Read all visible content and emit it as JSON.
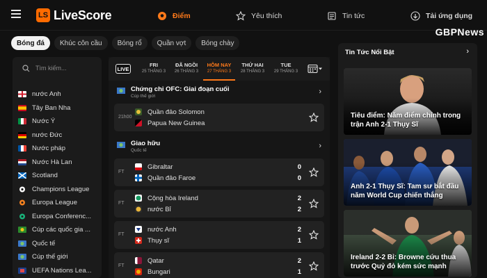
{
  "header": {
    "logo_text": "LiveScore",
    "logo_mark": "LS",
    "nav": [
      {
        "label": "Điểm",
        "icon": "soccer-ball-icon"
      },
      {
        "label": "Yêu thích",
        "icon": "star-icon"
      },
      {
        "label": "Tin tức",
        "icon": "news-icon"
      },
      {
        "label": "Tải ứng dụng",
        "icon": "download-icon"
      }
    ],
    "accent_color": "#ff7a1a"
  },
  "watermark": "GBPNews",
  "sport_tabs": [
    "Bóng đá",
    "Khúc côn cầu",
    "Bóng rổ",
    "Quần vợt",
    "Bóng chày"
  ],
  "sidebar": {
    "search_placeholder": "Tìm kiếm...",
    "countries": [
      {
        "label": "nước Anh",
        "flag": "england"
      },
      {
        "label": "Tây Ban Nha",
        "flag": "spain"
      },
      {
        "label": "Nước Ý",
        "flag": "italy"
      },
      {
        "label": "nước Đức",
        "flag": "germany"
      },
      {
        "label": "Nước pháp",
        "flag": "france"
      },
      {
        "label": "Nước Hà Lan",
        "flag": "netherlands"
      },
      {
        "label": "Scotland",
        "flag": "scotland"
      },
      {
        "label": "Champions League",
        "flag": "ucl"
      },
      {
        "label": "Europa League",
        "flag": "uel"
      },
      {
        "label": "Europa Conferenc...",
        "flag": "uecl"
      },
      {
        "label": "Cúp các quốc gia ...",
        "flag": "cup"
      },
      {
        "label": "Quốc tế",
        "flag": "world"
      },
      {
        "label": "Cúp thế giới",
        "flag": "worldcup"
      },
      {
        "label": "UEFA Nations Lea...",
        "flag": "nations"
      }
    ]
  },
  "datebar": {
    "live_label": "LIVE",
    "dates": [
      {
        "day": "FRI",
        "date": "25 THÁNG 3"
      },
      {
        "day": "ĐÃ NGỒI",
        "date": "26 THÁNG 3"
      },
      {
        "day": "HÔM NAY",
        "date": "27 THÁNG 3"
      },
      {
        "day": "THỨ HAI",
        "date": "28 THÁNG 3"
      },
      {
        "day": "TUE",
        "date": "29 THÁNG 3"
      }
    ]
  },
  "competitions": [
    {
      "name": "Chứng chỉ OFC: Giai đoạn cuối",
      "sub": "Cúp thế giới"
    },
    {
      "name": "Giao hữu",
      "sub": "Quốc tế"
    }
  ],
  "matches": [
    {
      "status": "21h00",
      "home": "Quần đảo Solomon",
      "away": "Papua New Guinea",
      "home_score": "",
      "away_score": ""
    },
    {
      "status": "FT",
      "home": "Gibraltar",
      "away": "Quần đảo Faroe",
      "home_score": "0",
      "away_score": "0"
    },
    {
      "status": "FT",
      "home": "Cộng hòa Ireland",
      "away": "nước Bỉ",
      "home_score": "2",
      "away_score": "2"
    },
    {
      "status": "FT",
      "home": "nước Anh",
      "away": "Thụy sĩ",
      "home_score": "2",
      "away_score": "1"
    },
    {
      "status": "FT",
      "home": "Qatar",
      "away": "Bungari",
      "home_score": "2",
      "away_score": "1"
    }
  ],
  "news": {
    "title": "Tin Tức Nổi Bật",
    "items": [
      {
        "caption": "Tiêu điểm: Năm điểm chính trong trận Anh 2-1 Thụy Sĩ"
      },
      {
        "caption": "Anh 2-1 Thụy Sĩ: Tam sư bắt đầu năm World Cup chiến thắng"
      },
      {
        "caption": "Ireland 2-2 Bỉ: Browne cứu thua trước Quỷ đỏ kém sức mạnh"
      }
    ]
  }
}
